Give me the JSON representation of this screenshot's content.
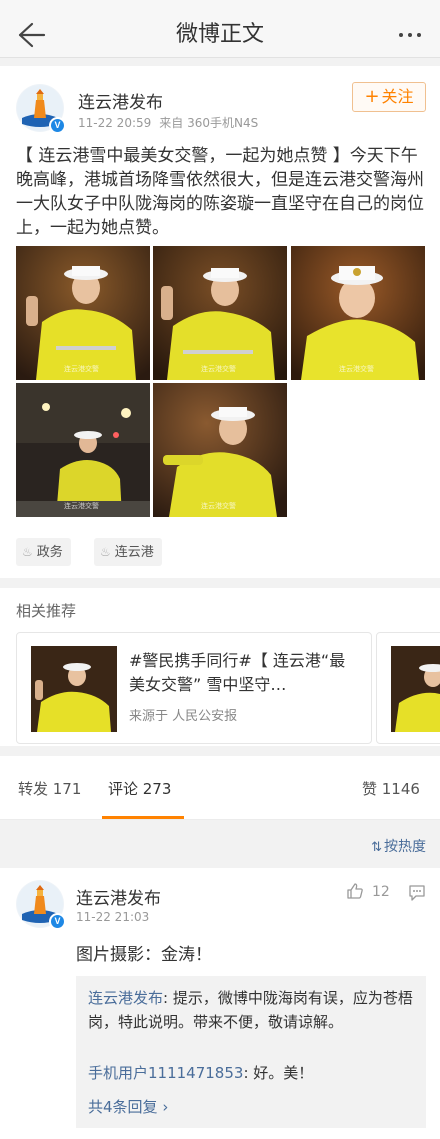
{
  "nav": {
    "title": "微博正文"
  },
  "post": {
    "author": "连云港发布",
    "time": "11-22 20:59",
    "source": "来自 360手机N4S",
    "follow_label": "关注",
    "text": "【 连云港雪中最美女交警，一起为她点赞 】今天下午晚高峰，港城首场降雪依然很大，但是连云港交警海州一大队女子中队陇海岗的陈姿璇一直坚守在自己的岗位上，一起为她点赞。",
    "photo_watermark": "连云港交警",
    "tags": [
      "政务",
      "连云港"
    ]
  },
  "recommend": {
    "title": "相关推荐",
    "card_text": "#警民携手同行#【 连云港“最美女交警” 雪中坚守…",
    "card_source": "来源于 人民公安报"
  },
  "tabs": {
    "repost": "转发 171",
    "comments": "评论 273",
    "likes": "赞 1146"
  },
  "sort_label": "按热度",
  "comment": {
    "author": "连云港发布",
    "time": "11-22 21:03",
    "likes": "12",
    "text": "图片摄影：金涛！",
    "replies": [
      {
        "user": "连云港发布",
        "text": "提示，微博中陇海岗有误，应为苍梧岗，特此说明。带来不便，敬请谅解。"
      },
      {
        "user": "手机用户1111471853",
        "text": "好。美！"
      }
    ],
    "more_replies": "共4条回复"
  },
  "colors": {
    "accent": "#ff8200",
    "link": "#4a6d9a",
    "verified": "#1e88e5"
  }
}
